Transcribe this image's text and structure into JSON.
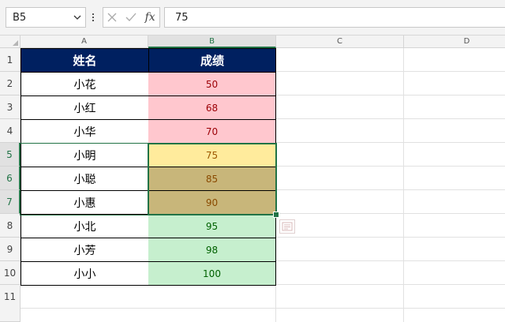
{
  "formula_bar": {
    "name_box": "B5",
    "formula": "75",
    "fx_label": "fx"
  },
  "columns": [
    "A",
    "B",
    "C",
    "D"
  ],
  "rows": [
    "1",
    "2",
    "3",
    "4",
    "5",
    "6",
    "7",
    "8",
    "9",
    "10",
    "11"
  ],
  "table": {
    "headers": [
      "姓名",
      "成绩"
    ],
    "records": [
      {
        "name": "小花",
        "score": "50"
      },
      {
        "name": "小红",
        "score": "68"
      },
      {
        "name": "小华",
        "score": "70"
      },
      {
        "name": "小明",
        "score": "75"
      },
      {
        "name": "小聪",
        "score": "85"
      },
      {
        "name": "小惠",
        "score": "90"
      },
      {
        "name": "小北",
        "score": "95"
      },
      {
        "name": "小芳",
        "score": "98"
      },
      {
        "name": "小小",
        "score": "100"
      }
    ]
  },
  "colors": {
    "header_fill": "#002060",
    "red_fill": "#ffc7ce",
    "red_text": "#9c0006",
    "yellow_fill": "#ffeb9c",
    "yellow_text": "#9c5700",
    "selected_fill": "#c8b67a",
    "green_fill": "#c6efce",
    "green_text": "#006100",
    "selection_border": "#217346"
  },
  "selection": {
    "range": "B5:B7",
    "active_cell": "B5"
  }
}
